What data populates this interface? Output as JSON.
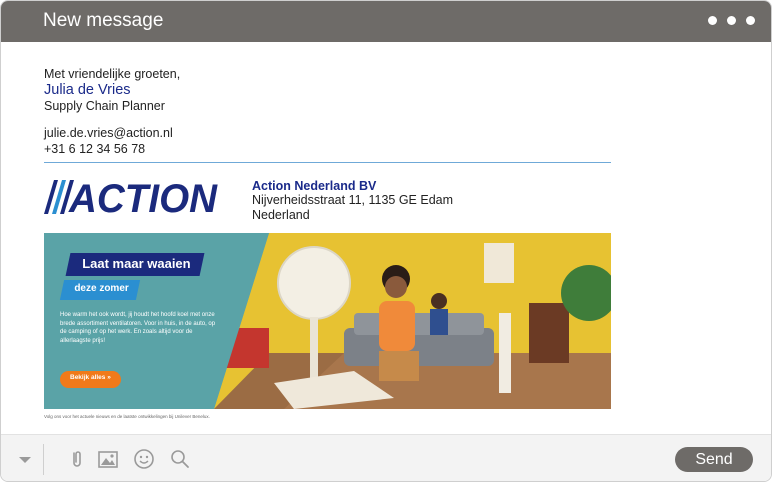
{
  "window": {
    "title": "New message"
  },
  "signature": {
    "greeting": "Met vriendelijke groeten,",
    "name": "Julia de Vries",
    "role": "Supply Chain Planner",
    "email": "julie.de.vries@action.nl",
    "phone": "+31 6 12 34 56 78",
    "logo_text": "ACTION",
    "company": "Action Nederland BV",
    "address_line1": "Nijverheidsstraat 11, 1135 GE Edam",
    "address_line2": "Nederland"
  },
  "banner": {
    "headline": "Laat maar waaien",
    "subheadline": "deze zomer",
    "body": "Hoe warm het ook wordt, jij houdt het hoofd koel met onze brede assortiment ventilatoren. Voor in huis, in de auto, op de camping of op het werk. En zoals altijd voor de allerlaagste prijs!",
    "cta": "Bekijk alles »"
  },
  "footnote": "Volg ons voor het actuele nieuws en de laatste ontwikkelingen bij Unilever Benelux.",
  "toolbar": {
    "send_label": "Send"
  },
  "colors": {
    "titlebar": "#6e6b68",
    "brand_blue": "#1b2a7d",
    "brand_light_blue": "#2b8fd1",
    "cta_orange": "#f07a1a",
    "divider": "#6fa9d8"
  }
}
